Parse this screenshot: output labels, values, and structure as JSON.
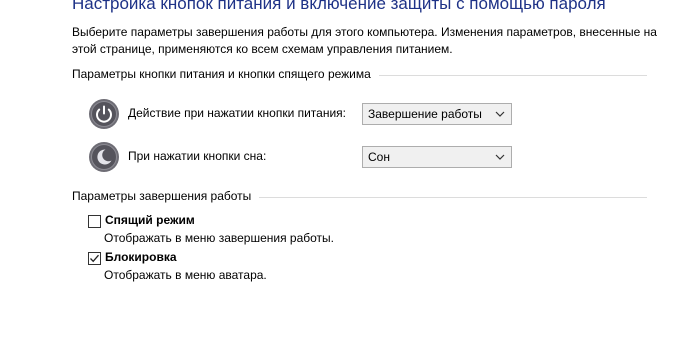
{
  "header": {
    "title": "Настройка кнопок питания и включение защиты с помощью пароля",
    "description": "Выберите параметры завершения работы для этого компьютера. Изменения параметров, внесенные на этой странице, применяются ко всем схемам управления питанием."
  },
  "power_buttons": {
    "section_title": "Параметры кнопки питания и кнопки спящего режима",
    "power_button": {
      "icon": "power-icon",
      "label": "Действие при нажатии кнопки питания:",
      "value": "Завершение работы"
    },
    "sleep_button": {
      "icon": "sleep-moon-icon",
      "label": "При нажатии кнопки сна:",
      "value": "Сон"
    }
  },
  "shutdown_settings": {
    "section_title": "Параметры завершения работы",
    "options": [
      {
        "label": "Спящий режим",
        "description": "Отображать в меню завершения работы.",
        "checked": false
      },
      {
        "label": "Блокировка",
        "description": "Отображать в меню аватара.",
        "checked": true
      }
    ]
  },
  "colors": {
    "title": "#1e3287",
    "icon_dark": "#55545c",
    "select_bg": "#f0f0f0"
  }
}
